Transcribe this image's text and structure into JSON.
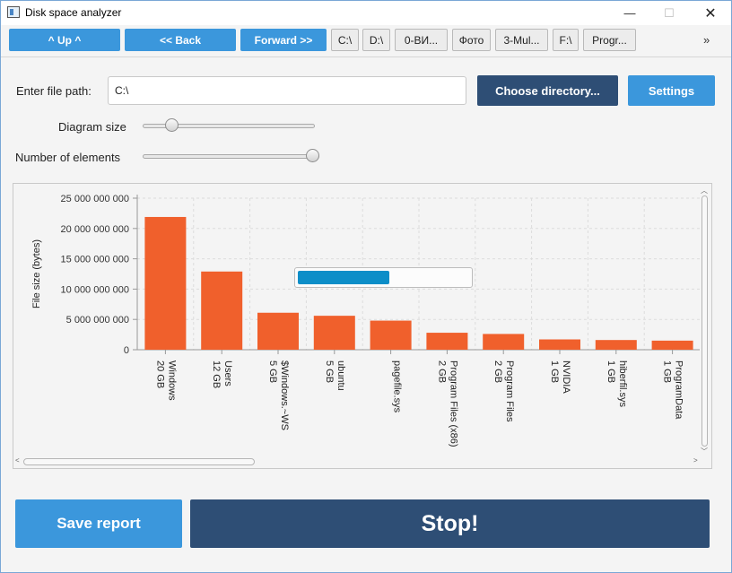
{
  "window": {
    "title": "Disk space analyzer",
    "minimize": "—",
    "maximize": "☐",
    "close": "✕"
  },
  "toolbar": {
    "up_label": "^ Up ^",
    "back_label": "<< Back",
    "forward_label": "Forward >>",
    "drives": [
      "C:\\",
      "D:\\",
      "0-ВИ...",
      "Фото",
      "3-Mul...",
      "F:\\",
      "Progr..."
    ],
    "overflow_label": "»"
  },
  "path": {
    "label": "Enter file path:",
    "value": "C:\\",
    "choose_label": "Choose directory...",
    "settings_label": "Settings"
  },
  "sliders": {
    "diagram_size_label": "Diagram size",
    "diagram_size_value": 0.14,
    "elements_label": "Number of elements",
    "elements_value": 1.0
  },
  "chart_data": {
    "type": "bar",
    "ylabel": "File size (bytes)",
    "ylim": [
      0,
      25000000000
    ],
    "yticks": [
      "0",
      "5 000 000 000",
      "10 000 000 000",
      "15 000 000 000",
      "20 000 000 000",
      "25 000 000 000"
    ],
    "categories": [
      {
        "name": "Windows",
        "size": "20 GB"
      },
      {
        "name": "Users",
        "size": "12 GB"
      },
      {
        "name": "$Windows.~WS",
        "size": "5 GB"
      },
      {
        "name": "ubuntu",
        "size": "5 GB"
      },
      {
        "name": "pagefile.sys",
        "size": ""
      },
      {
        "name": "Program Files (x86)",
        "size": "2 GB"
      },
      {
        "name": "Program Files",
        "size": "2 GB"
      },
      {
        "name": "NVIDIA",
        "size": "1 GB"
      },
      {
        "name": "hiberfil.sys",
        "size": "1 GB"
      },
      {
        "name": "ProgramData",
        "size": "1 GB"
      }
    ],
    "values": [
      21900000000,
      12900000000,
      6100000000,
      5600000000,
      4800000000,
      2800000000,
      2600000000,
      1700000000,
      1600000000,
      1500000000
    ],
    "bar_color": "#f0602c",
    "grid": true
  },
  "progress": {
    "value": 0.53,
    "color": "#0c8ec8"
  },
  "footer": {
    "save_label": "Save report",
    "stop_label": "Stop!"
  }
}
